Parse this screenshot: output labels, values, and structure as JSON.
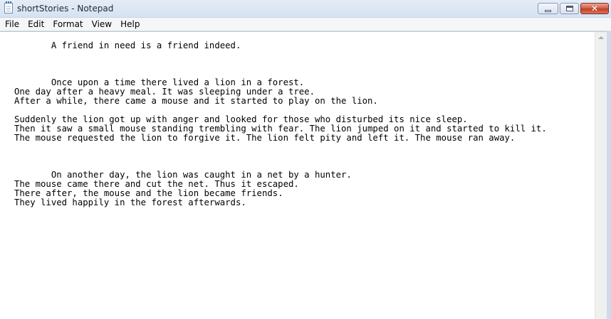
{
  "window": {
    "title": "shortStories - Notepad"
  },
  "menu": {
    "items": [
      "File",
      "Edit",
      "Format",
      "View",
      "Help"
    ]
  },
  "document": {
    "text": "       A friend in need is a friend indeed.\n\n\n\n       Once upon a time there lived a lion in a forest.\nOne day after a heavy meal. It was sleeping under a tree.\nAfter a while, there came a mouse and it started to play on the lion.\n\nSuddenly the lion got up with anger and looked for those who disturbed its nice sleep.\nThen it saw a small mouse standing trembling with fear. The lion jumped on it and started to kill it.\nThe mouse requested the lion to forgive it. The lion felt pity and left it. The mouse ran away.\n\n\n\n       On another day, the lion was caught in a net by a hunter.\nThe mouse came there and cut the net. Thus it escaped.\nThere after, the mouse and the lion became friends.\nThey lived happily in the forest afterwards."
  },
  "icons": {
    "app": "notepad-icon",
    "minimize": "minimize-icon",
    "maximize": "maximize-icon",
    "close": "close-icon",
    "scroll_up": "scroll-up-arrow-icon"
  },
  "colors": {
    "close_button": "#c03b23",
    "titlebar": "#dfe9f5"
  }
}
